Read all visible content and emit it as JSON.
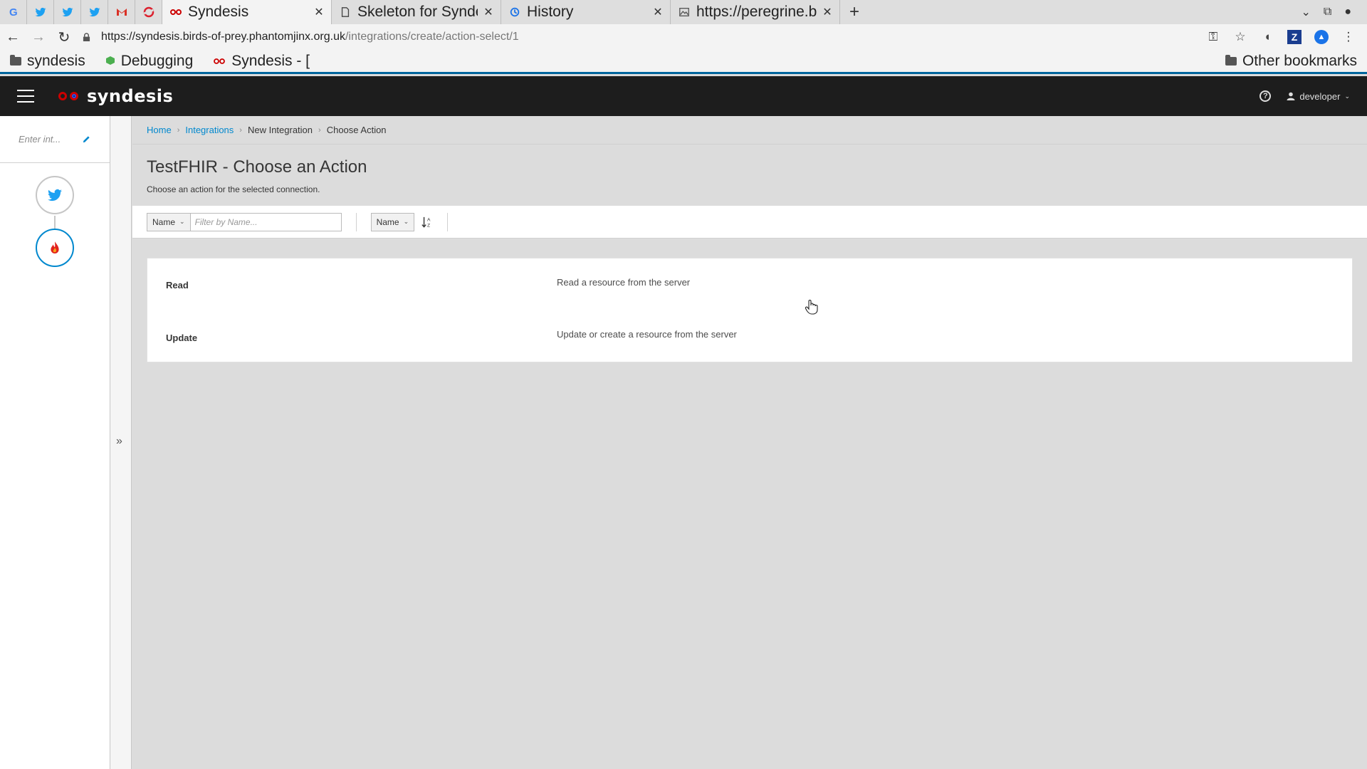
{
  "browser": {
    "tabs": [
      {
        "title": "Syndesis",
        "active": true
      },
      {
        "title": "Skeleton for Synde",
        "active": false
      },
      {
        "title": "History",
        "active": false
      },
      {
        "title": "https://peregrine.b",
        "active": false
      }
    ],
    "address": {
      "host": "https://syndesis.birds-of-prey.phantomjinx.org.uk",
      "path": "/integrations/create/action-select/1"
    },
    "bookmarks": [
      {
        "label": "syndesis",
        "icon": "folder-icon"
      },
      {
        "label": "Debugging",
        "icon": "cube-icon"
      },
      {
        "label": "Syndesis - [",
        "icon": "syndesis-logo-icon"
      }
    ],
    "other_bookmarks": "Other bookmarks"
  },
  "app": {
    "brand": "syndesis",
    "user": "developer",
    "accent_color": "#0088ce",
    "masthead_color": "#1d1d1d"
  },
  "editor": {
    "name_placeholder": "Enter int...",
    "steps": [
      {
        "icon": "twitter-icon"
      },
      {
        "icon": "fhir-flame-icon"
      }
    ]
  },
  "breadcrumb": {
    "home": "Home",
    "integrations": "Integrations",
    "new_integration": "New Integration",
    "current": "Choose Action"
  },
  "page": {
    "title": "TestFHIR - Choose an Action",
    "description": "Choose an action for the selected connection."
  },
  "filter": {
    "field": "Name",
    "placeholder": "Filter by Name...",
    "sort_field": "Name"
  },
  "actions": [
    {
      "name": "Read",
      "description": "Read a resource from the server"
    },
    {
      "name": "Update",
      "description": "Update or create a resource from the server"
    }
  ]
}
